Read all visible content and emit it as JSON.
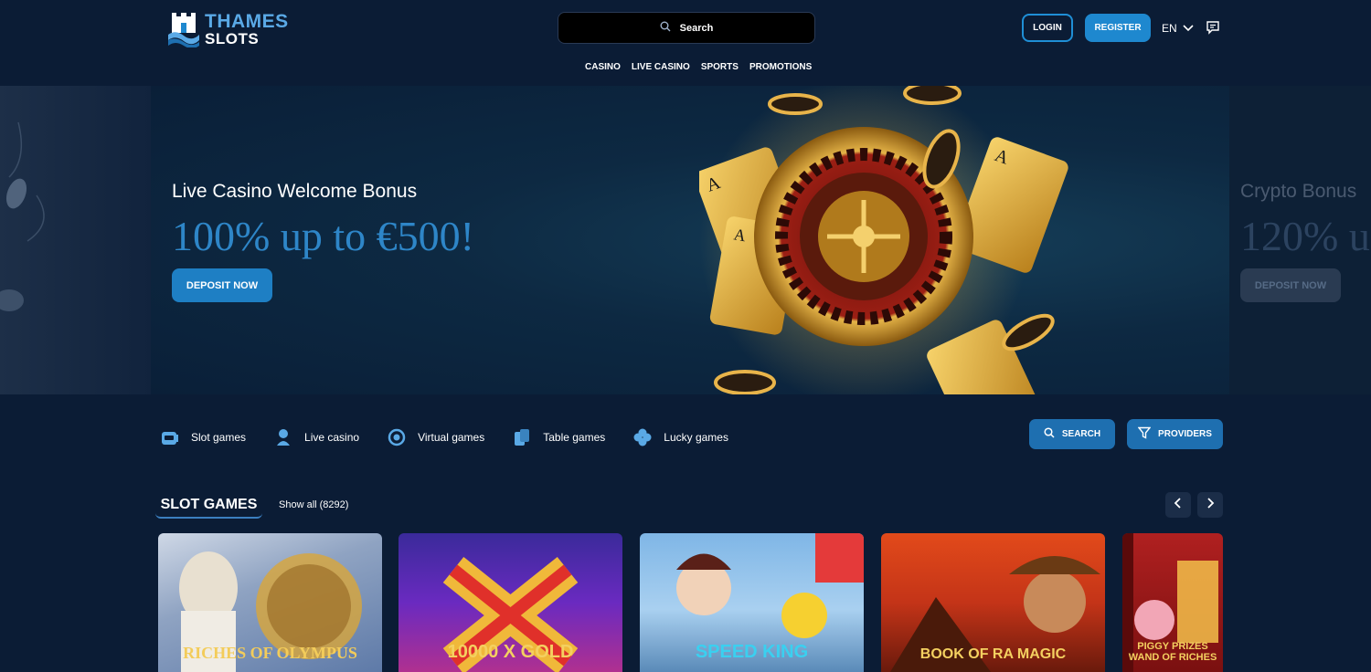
{
  "header": {
    "logo_line1": "THAMES",
    "logo_line2": "SLOTS",
    "search_placeholder": "Search",
    "login_label": "LOGIN",
    "register_label": "REGISTER",
    "language": "EN"
  },
  "nav": {
    "items": [
      "CASINO",
      "LIVE CASINO",
      "SPORTS",
      "PROMOTIONS"
    ]
  },
  "banner": {
    "title": "Live Casino Welcome Bonus",
    "amount": "100% up to €500!",
    "cta": "DEPOSIT NOW",
    "next_title": "Crypto Bonus",
    "next_amount": "120% u",
    "next_cta": "DEPOSIT NOW"
  },
  "categories": {
    "items": [
      {
        "label": "Slot games",
        "icon": "slot-machine-icon"
      },
      {
        "label": "Live casino",
        "icon": "dealer-icon"
      },
      {
        "label": "Virtual games",
        "icon": "virtual-icon"
      },
      {
        "label": "Table games",
        "icon": "cards-icon"
      },
      {
        "label": "Lucky games",
        "icon": "clover-icon"
      }
    ],
    "search_label": "SEARCH",
    "providers_label": "PROVIDERS"
  },
  "slots": {
    "section_title": "SLOT GAMES",
    "show_all": "Show all (8292)",
    "games": [
      {
        "title": "RICHES OF OLYMPUS"
      },
      {
        "title": "10000 X GOLD"
      },
      {
        "title": "SPEED KING"
      },
      {
        "title": "BOOK OF RA MAGIC"
      },
      {
        "title": "PIGGY PRIZES WAND OF RICHES"
      }
    ]
  },
  "colors": {
    "background": "#0b1c35",
    "accent": "#1e88cf",
    "amount_blue": "#2e86c8"
  }
}
